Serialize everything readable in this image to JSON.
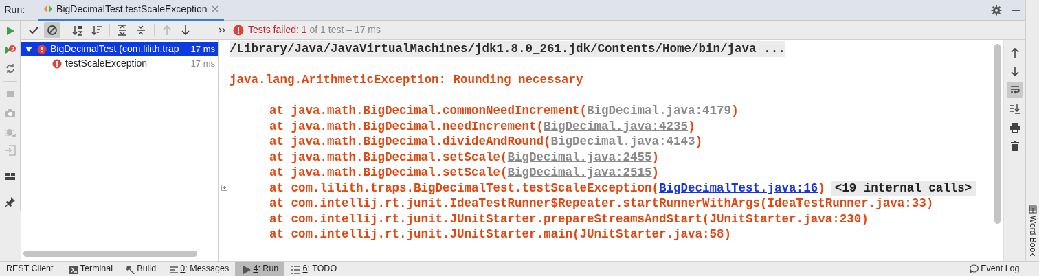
{
  "run_window": {
    "label": "Run:",
    "tab": {
      "title": "BigDecimalTest.testScaleException",
      "selected": true
    }
  },
  "side_toolbar": [
    {
      "disabled": false
    },
    {
      "disabled": false
    },
    {
      "disabled": false
    },
    {
      "disabled": true
    },
    {
      "disabled": true
    },
    {
      "disabled": true
    },
    {
      "disabled": true
    },
    {
      "disabled": false
    },
    {
      "disabled": false
    }
  ],
  "test_toolbar": [
    {
      "selected": false,
      "disabled": false
    },
    {
      "selected": true,
      "disabled": false
    },
    {
      "selected": false,
      "disabled": false
    },
    {
      "selected": false,
      "disabled": false
    },
    {
      "selected": false,
      "disabled": false
    },
    {
      "selected": false,
      "disabled": false
    },
    {
      "selected": false,
      "disabled": true
    },
    {
      "selected": false,
      "disabled": false
    }
  ],
  "status": {
    "failed_label": "Tests failed:",
    "failed_count": "1",
    "rest": "of 1 test – 17 ms"
  },
  "tree": [
    {
      "label": "BigDecimalTest (com.lilith.trap",
      "time": "17 ms",
      "selected": true,
      "expanded": true,
      "children": [
        {
          "label": "testScaleException",
          "time": "17 ms",
          "selected": false
        }
      ]
    }
  ],
  "console": {
    "command": "/Library/Java/JavaVirtualMachines/jdk1.8.0_261.jdk/Contents/Home/bin/java ...",
    "exception": "java.lang.ArithmeticException: Rounding necessary",
    "stack": [
      {
        "text": "at java.math.BigDecimal.commonNeedIncrement(",
        "link": "BigDecimal.java:4179",
        "kind": "library",
        "suffix": ")"
      },
      {
        "text": "at java.math.BigDecimal.needIncrement(",
        "link": "BigDecimal.java:4235",
        "kind": "library",
        "suffix": ")"
      },
      {
        "text": "at java.math.BigDecimal.divideAndRound(",
        "link": "BigDecimal.java:4143",
        "kind": "library",
        "suffix": ")"
      },
      {
        "text": "at java.math.BigDecimal.setScale(",
        "link": "BigDecimal.java:2455",
        "kind": "library",
        "suffix": ")"
      },
      {
        "text": "at java.math.BigDecimal.setScale(",
        "link": "BigDecimal.java:2515",
        "kind": "library",
        "suffix": ")"
      },
      {
        "text": "at com.lilith.traps.BigDecimalTest.testScaleException(",
        "link": "BigDecimalTest.java:16",
        "kind": "project",
        "suffix": ")",
        "folded": "<19 internal calls>"
      },
      {
        "text": "at com.intellij.rt.junit.IdeaTestRunner$Repeater.startRunnerWithArgs(IdeaTestRunner.java:33)"
      },
      {
        "text": "at com.intellij.rt.junit.JUnitStarter.prepareStreamsAndStart(JUnitStarter.java:230)"
      },
      {
        "text": "at com.intellij.rt.junit.JUnitStarter.main(JUnitStarter.java:58)"
      }
    ]
  },
  "console_toolbar": [
    {
      "selected": false
    },
    {
      "selected": false
    },
    {
      "selected": true
    },
    {
      "selected": false
    },
    {
      "selected": false
    },
    {
      "selected": false
    }
  ],
  "word_book": {
    "label": "Word Book"
  },
  "bottom_tabs": [
    {
      "label": "REST Client",
      "selected": false
    },
    {
      "label": "Terminal",
      "selected": false
    },
    {
      "label": "Build",
      "selected": false
    },
    {
      "mnemonic": "0",
      "label": ": Messages",
      "selected": false
    },
    {
      "mnemonic": "4",
      "label": ": Run",
      "selected": true
    },
    {
      "mnemonic": "6",
      "label": ": TODO",
      "selected": false
    }
  ],
  "event_log": {
    "label": "Event Log"
  }
}
